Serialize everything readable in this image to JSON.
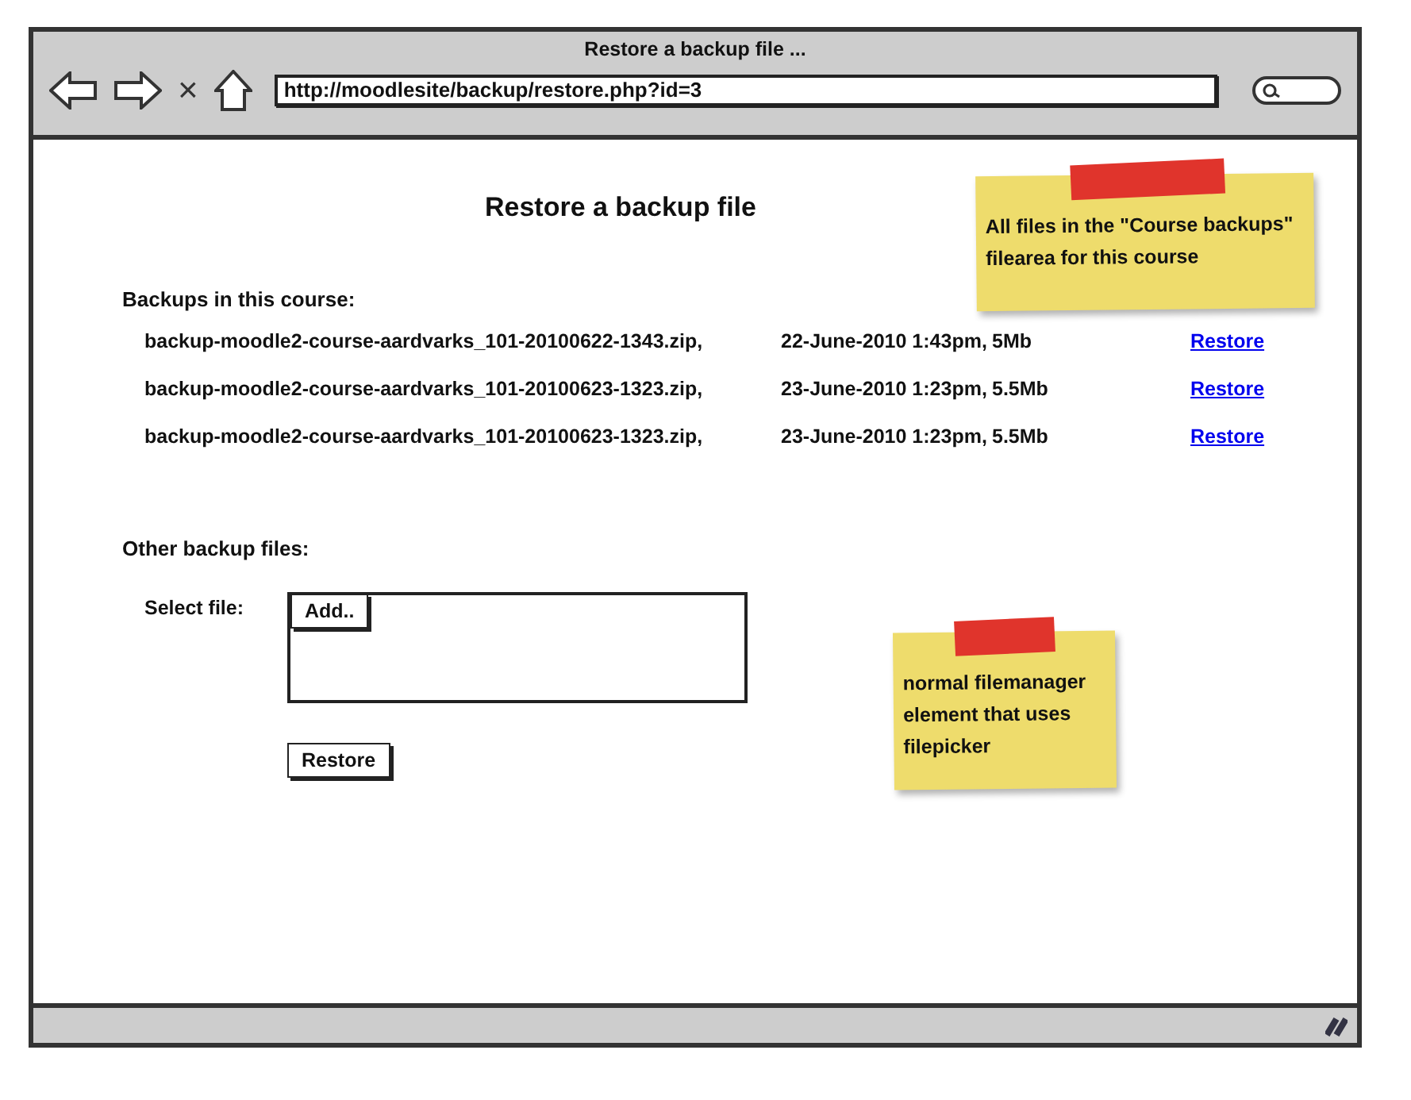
{
  "window": {
    "title": "Restore a backup file ...",
    "url": "http://moodlesite/backup/restore.php?id=3",
    "stop_glyph": "×"
  },
  "page": {
    "heading": "Restore a backup file",
    "backups_label": "Backups in this course:",
    "backups": [
      {
        "file": "backup-moodle2-course-aardvarks_101-20100622-1343.zip,",
        "date": "22-June-2010 1:43pm,",
        "size": "5Mb",
        "action": "Restore"
      },
      {
        "file": "backup-moodle2-course-aardvarks_101-20100623-1323.zip,",
        "date": "23-June-2010 1:23pm,",
        "size": "5.5Mb",
        "action": "Restore"
      },
      {
        "file": "backup-moodle2-course-aardvarks_101-20100623-1323.zip,",
        "date": "23-June-2010 1:23pm,",
        "size": "5.5Mb",
        "action": "Restore"
      }
    ],
    "other_label": "Other backup files:",
    "select_label": "Select file:",
    "add_button": "Add..",
    "restore_button": "Restore"
  },
  "notes": [
    {
      "text": "All files in the \"Course backups\" filearea for this course"
    },
    {
      "text": "normal filemanager element that uses filepicker"
    }
  ]
}
